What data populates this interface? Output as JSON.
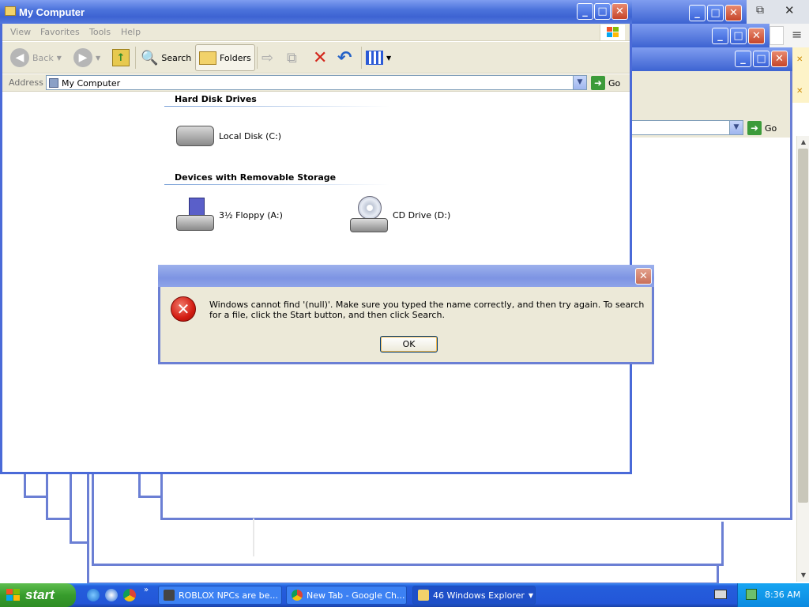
{
  "window": {
    "title": "My Computer",
    "menu": [
      "View",
      "Favorites",
      "Tools",
      "Help"
    ],
    "toolbar": {
      "back": "Back",
      "search": "Search",
      "folders": "Folders"
    },
    "address": {
      "label": "Address",
      "value": "My Computer",
      "go": "Go"
    },
    "groups": [
      {
        "header": "Hard Disk Drives",
        "items": [
          {
            "label": "Local Disk (C:)",
            "icon": "hard-disk-icon"
          }
        ]
      },
      {
        "header": "Devices with Removable Storage",
        "items": [
          {
            "label": "3½ Floppy (A:)",
            "icon": "floppy-drive-icon"
          },
          {
            "label": "CD Drive (D:)",
            "icon": "cd-drive-icon"
          }
        ]
      }
    ]
  },
  "background_window": {
    "go": "Go"
  },
  "dialog": {
    "message": "Windows cannot find '(null)'. Make sure you typed the name correctly, and then try again. To search for a file, click the Start button, and then click Search.",
    "ok": "OK",
    "icon": "error-icon"
  },
  "taskbar": {
    "start": "start",
    "tasks": [
      {
        "label": "ROBLOX NPCs are be...",
        "icon": "roblox-icon"
      },
      {
        "label": "New Tab - Google Ch...",
        "icon": "chrome-icon"
      },
      {
        "label": "46 Windows Explorer",
        "icon": "folder-icon"
      }
    ],
    "clock": "8:36 AM"
  },
  "colors": {
    "titlebar": "#3d63d2",
    "taskbar": "#245edc",
    "start": "#379c2c",
    "error": "#d31c12"
  }
}
